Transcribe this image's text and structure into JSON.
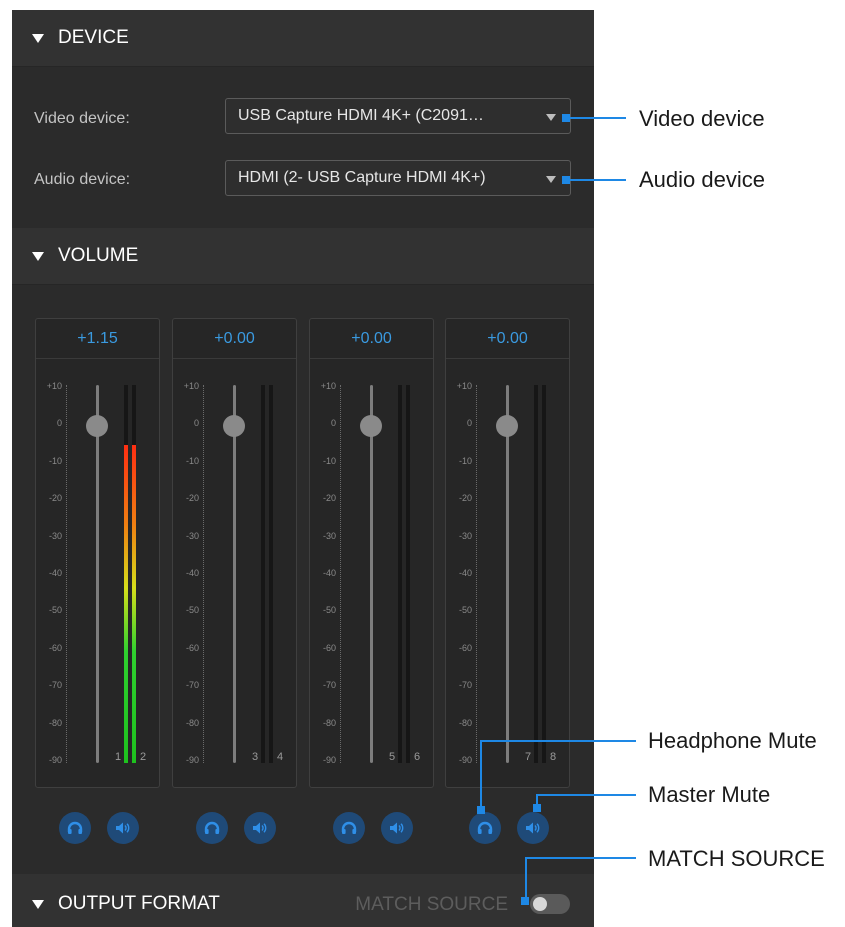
{
  "device": {
    "header": "DEVICE",
    "video_label": "Video device:",
    "video_value": "USB Capture HDMI 4K+ (C2091…",
    "audio_label": "Audio device:",
    "audio_value": "HDMI (2- USB Capture HDMI 4K+)"
  },
  "volume": {
    "header": "VOLUME",
    "scale": [
      "+10",
      "0",
      "-10",
      "-20",
      "-30",
      "-40",
      "-50",
      "-60",
      "-70",
      "-80",
      "-90"
    ],
    "channels": [
      {
        "value": "+1.15",
        "left": "1",
        "right": "2",
        "level": 0.84
      },
      {
        "value": "+0.00",
        "left": "3",
        "right": "4",
        "level": 0
      },
      {
        "value": "+0.00",
        "left": "5",
        "right": "6",
        "level": 0
      },
      {
        "value": "+0.00",
        "left": "7",
        "right": "8",
        "level": 0
      }
    ]
  },
  "output": {
    "header": "OUTPUT FORMAT",
    "match_source": "MATCH SOURCE"
  },
  "callouts": {
    "video": "Video device",
    "audio": "Audio device",
    "headphone": "Headphone Mute",
    "master": "Master Mute",
    "match": "MATCH SOURCE"
  },
  "colors": {
    "accent": "#1e88e5",
    "value_text": "#3a9ae0",
    "mute_button": "#1f4a78"
  },
  "icons": {
    "headphone": "headphone-icon",
    "speaker": "speaker-icon"
  }
}
